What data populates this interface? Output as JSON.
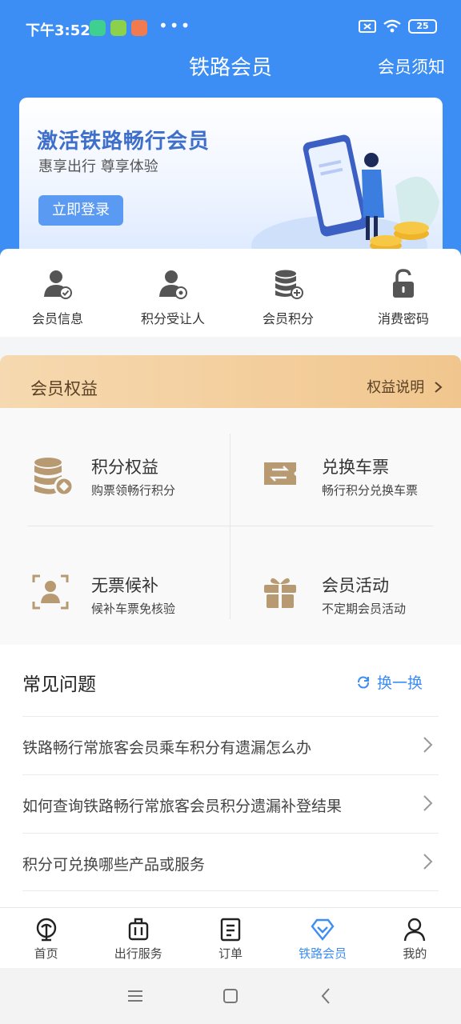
{
  "status": {
    "time": "下午3:52",
    "dots": "•••",
    "battery": "25"
  },
  "header": {
    "title": "铁路会员",
    "link": "会员须知"
  },
  "banner": {
    "title": "激活铁路畅行会员",
    "subtitle": "惠享出行  尊享体验",
    "button": "立即登录"
  },
  "quick": [
    {
      "label": "会员信息",
      "icon": "member-info-icon"
    },
    {
      "label": "积分受让人",
      "icon": "points-transferee-icon"
    },
    {
      "label": "会员积分",
      "icon": "member-points-icon"
    },
    {
      "label": "消费密码",
      "icon": "lock-icon"
    }
  ],
  "benefits": {
    "title": "会员权益",
    "link": "权益说明",
    "items": [
      {
        "name": "积分权益",
        "desc": "购票领畅行积分",
        "icon": "points-stack-icon"
      },
      {
        "name": "兑换车票",
        "desc": "畅行积分兑换车票",
        "icon": "ticket-exchange-icon"
      },
      {
        "name": "无票候补",
        "desc": "候补车票免核验",
        "icon": "face-scan-icon"
      },
      {
        "name": "会员活动",
        "desc": "不定期会员活动",
        "icon": "gift-icon"
      }
    ]
  },
  "faq": {
    "title": "常见问题",
    "refresh": "换一换",
    "items": [
      "铁路畅行常旅客会员乘车积分有遗漏怎么办",
      "如何查询铁路畅行常旅客会员积分遗漏补登结果",
      "积分可兑换哪些产品或服务"
    ]
  },
  "tabs": [
    {
      "label": "首页",
      "icon": "home-rail-icon",
      "active": false
    },
    {
      "label": "出行服务",
      "icon": "luggage-icon",
      "active": false
    },
    {
      "label": "订单",
      "icon": "order-icon",
      "active": false
    },
    {
      "label": "铁路会员",
      "icon": "diamond-icon",
      "active": true
    },
    {
      "label": "我的",
      "icon": "profile-icon",
      "active": false
    }
  ],
  "colors": {
    "primary": "#3d8ef4",
    "gold": "#f1c68e",
    "benefit_icon": "#b89a72"
  }
}
